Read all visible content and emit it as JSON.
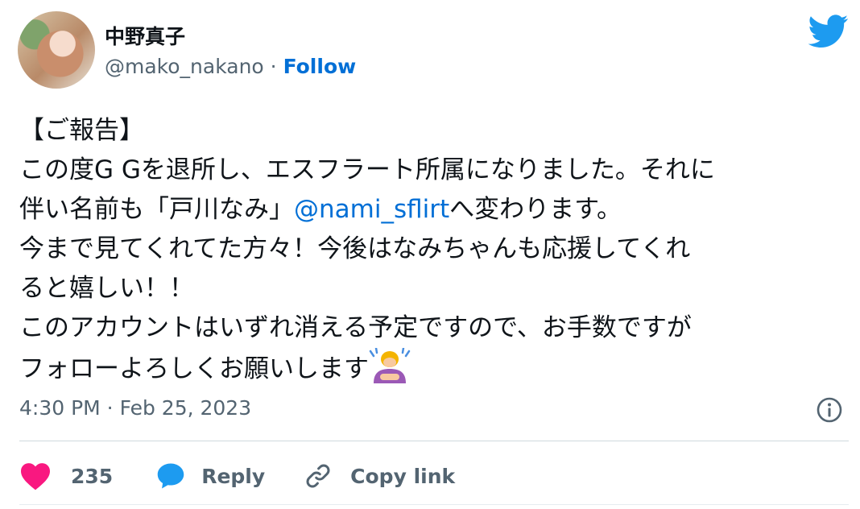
{
  "author": {
    "name": "中野真子",
    "handle": "@mako_nakano",
    "separator": " · ",
    "follow_label": "Follow"
  },
  "tweet": {
    "line1": "【ご報告】",
    "line2": "この度G Gを退所し、エスフラート所属になりました。それに",
    "line3_pre": "伴い名前も「戸川なみ」",
    "mention": "@nami_sflirt",
    "line3_post": "へ変わります。",
    "line4": "今まで見てくれてた方々！今後はなみちゃんも応援してくれ",
    "line5": "ると嬉しい！！",
    "line6": "このアカウントはいずれ消える予定ですので、お手数ですが",
    "line7": "フォローよろしくお願いします",
    "emoji": "person-bowing-emoji",
    "timestamp": "4:30 PM · Feb 25, 2023"
  },
  "actions": {
    "like_count": "235",
    "reply_label": "Reply",
    "copy_label": "Copy link"
  },
  "colors": {
    "link": "#006fd6",
    "twitter_blue": "#1d9bf0",
    "like": "#f91880",
    "muted": "#536471"
  },
  "icons": [
    "twitter-bird-icon",
    "info-icon",
    "heart-icon",
    "reply-bubble-icon",
    "link-icon"
  ]
}
